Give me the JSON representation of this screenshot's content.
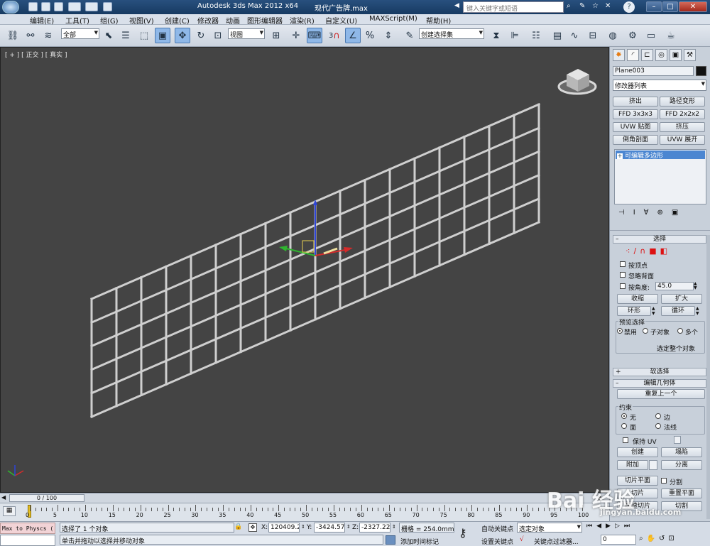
{
  "titlebar": {
    "app_title": "Autodesk 3ds Max  2012 x64",
    "file_name": "现代广告牌.max",
    "search_placeholder": "键入关键字或短语",
    "icons": [
      "binoculars-icon",
      "tools-icon",
      "star-icon",
      "close-icon",
      "help-icon"
    ],
    "window_buttons": {
      "minimize": "–",
      "maximize": "□",
      "close": "✕"
    }
  },
  "menu": {
    "items": [
      "编辑(E)",
      "工具(T)",
      "组(G)",
      "视图(V)",
      "创建(C)",
      "修改器",
      "动画",
      "图形编辑器",
      "渲染(R)",
      "自定义(U)",
      "MAXScript(M)",
      "帮助(H)"
    ]
  },
  "toolbar": {
    "selection_filter": "全部",
    "ref_coord": "视图",
    "snap_value": "3",
    "named_selection": "创建选择集",
    "icons": [
      "link-icon",
      "unlink-icon",
      "bind-spacewarp-icon",
      "select-object-icon",
      "select-by-name-icon",
      "rect-region-icon",
      "window-crossing-icon",
      "move-icon",
      "rotate-icon",
      "scale-icon",
      "pivot-icon",
      "manipulate-icon",
      "keyboard-shortcut-icon",
      "snap-toggle-icon",
      "angle-snap-icon",
      "percent-snap-icon",
      "spinner-snap-icon",
      "edit-named-sets-icon",
      "mirror-icon",
      "align-icon",
      "layer-manager-icon",
      "graphite-ribbon-icon",
      "curve-editor-icon",
      "schematic-view-icon",
      "material-editor-icon",
      "render-setup-icon",
      "rendered-frame-icon",
      "render-icon"
    ]
  },
  "viewport": {
    "label": "[ + ][ 正交 ][ 真实 ]",
    "label_parts": [
      "[ + ]",
      "[ 正交 ]",
      "[ 真实 ]"
    ],
    "grid_columns": 18,
    "grid_rows": 5,
    "gizmo_axes": [
      "x",
      "y",
      "z"
    ],
    "colors": {
      "background": "#444444",
      "mesh": "#cfcfcf",
      "x_axis": "#d52b2b",
      "y_axis": "#2fb52f",
      "z_axis": "#2f45d8"
    }
  },
  "time": {
    "frame_display": "0 / 100",
    "ticks": [
      "0",
      "5",
      "10",
      "15",
      "20",
      "25",
      "30",
      "35",
      "40",
      "45",
      "50",
      "55",
      "60",
      "65",
      "70",
      "75",
      "80",
      "85",
      "90",
      "95",
      "100"
    ]
  },
  "status": {
    "maxscript_listener": "Max to Physcs (",
    "selection_info": "选择了 1 个对象",
    "prompt": "单击并拖动以选择并移动对象",
    "x_label": "X:",
    "x_value": "120409.29",
    "y_label": "Y:",
    "y_value": "-3424.571",
    "z_label": "Z:",
    "z_value": "-2327.222",
    "grid": "栅格 = 254.0mm",
    "add_time_tag": "添加时间标记",
    "auto_key": "自动关键点",
    "set_key": "设置关键点",
    "selected_mode": "选定对象",
    "key_filters": "关键点过滤器...",
    "current_frame": "0"
  },
  "command_panel": {
    "tabs": [
      "create-tab",
      "modify-tab",
      "hierarchy-tab",
      "motion-tab",
      "display-tab",
      "utilities-tab"
    ],
    "object_name": "Plane003",
    "object_color": "#111111",
    "modifier_list": "修改器列表",
    "modifier_buttons": [
      "挤出",
      "路径变形",
      "FFD 3x3x3",
      "FFD 2x2x2",
      "UVW 贴图",
      "挤压",
      "倒角剖面",
      "UVW 展开"
    ],
    "stack_items": [
      "可编辑多边形"
    ],
    "select_rollout": {
      "title": "选择",
      "by_vertex": "按顶点",
      "ignore_backfacing": "忽略背面",
      "by_angle": "按角度:",
      "angle_value": "45.0",
      "shrink": "收缩",
      "grow": "扩大",
      "ring": "环形",
      "loop": "循环",
      "preview_title": "预览选择",
      "preview_options": [
        "禁用",
        "子对象",
        "多个"
      ],
      "whole_object": "选定整个对象"
    },
    "soft_selection": "软选择",
    "edit_geometry": {
      "title": "编辑几何体",
      "repeat_last": "重复上一个",
      "constraints_title": "约束",
      "constraints": [
        "无",
        "边",
        "面",
        "法线"
      ],
      "preserve_uv": "保持 UV",
      "create": "创建",
      "collapse": "塌陷",
      "attach": "附加",
      "detach": "分离",
      "slice_plane": "切片平面",
      "split": "分割",
      "slice": "切片",
      "reset_plane": "重置平面",
      "quickslice": "快速切片",
      "cut": "切割"
    }
  },
  "watermark": {
    "brand": "Bai 经验",
    "url": "jingyan.baidu.com"
  }
}
